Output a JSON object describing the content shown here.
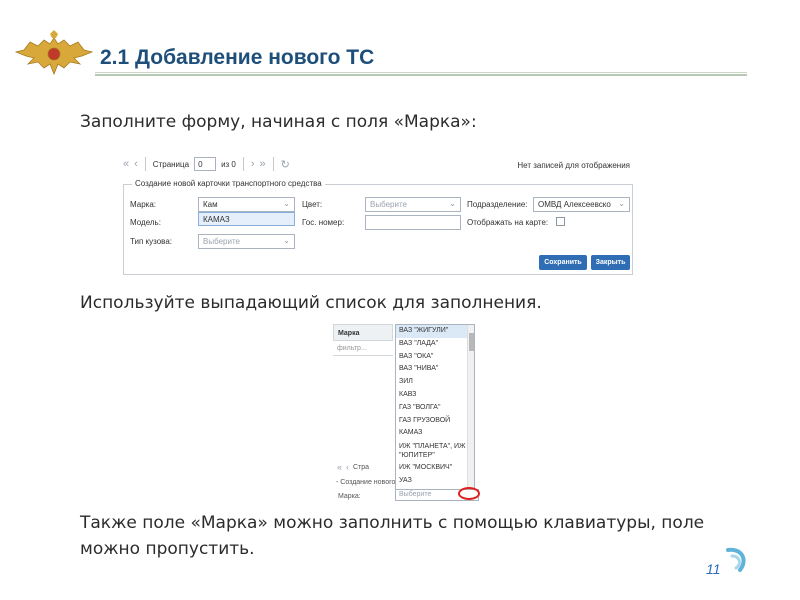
{
  "slide": {
    "title": "2.1 Добавление нового ТС",
    "text1": "Заполните форму, начиная с поля «Марка»:",
    "text2": "Используйте выпадающий список для заполнения.",
    "text3": "Также поле «Марка» можно заполнить с помощью клавиатуры, поле можно пропустить.",
    "page_number": "11"
  },
  "pager": {
    "first_icon": "double-chevron-left-icon",
    "prev_icon": "chevron-left-icon",
    "page_label": "Страница",
    "page_value": "0",
    "of_label": "из 0",
    "next_icon": "chevron-right-icon",
    "last_icon": "double-chevron-right-icon",
    "refresh_icon": "refresh-icon",
    "no_records": "Нет записей для отображения"
  },
  "form": {
    "legend": "Создание новой карточки транспортного средства",
    "marka_label": "Марка:",
    "marka_value": "Кам",
    "marka_option": "КАМАЗ",
    "model_label": "Модель:",
    "body_type_label": "Тип кузова:",
    "body_type_placeholder": "Выберите",
    "color_label": "Цвет:",
    "color_placeholder": "Выберите",
    "gos_number_label": "Гос. номер:",
    "division_label": "Подразделение:",
    "division_value": "ОМВД Алексеевско",
    "show_on_map_label": "Отображать на карте:",
    "show_on_map_checked": true,
    "save_button": "Сохранить",
    "close_button": "Закрыть"
  },
  "dropdown_shot": {
    "grid_header": "Марка",
    "grid_filter": "фильтр...",
    "pager_text": "Стра",
    "legend_fragment": "- Создание нового ТС",
    "marka_label": "Марка:",
    "select_placeholder": "Выберите",
    "items": [
      "ВАЗ \"ЖИГУЛИ\"",
      "ВАЗ \"ЛАДА\"",
      "ВАЗ \"ОКА\"",
      "ВАЗ \"НИВА\"",
      "ЗИЛ",
      "КАВЗ",
      "ГАЗ \"ВОЛГА\"",
      "ГАЗ ГРУЗОВОЙ",
      "КАМАЗ",
      "ИЖ \"ПЛАНЕТА\", ИЖ \"ЮПИТЕР\"",
      "ИЖ \"МОСКВИЧ\"",
      "УАЗ"
    ]
  },
  "colors": {
    "title": "#1e4f7a",
    "accent_button": "#2f6db5",
    "highlight_circle": "#e02020",
    "page_number": "#2a6ebb"
  }
}
